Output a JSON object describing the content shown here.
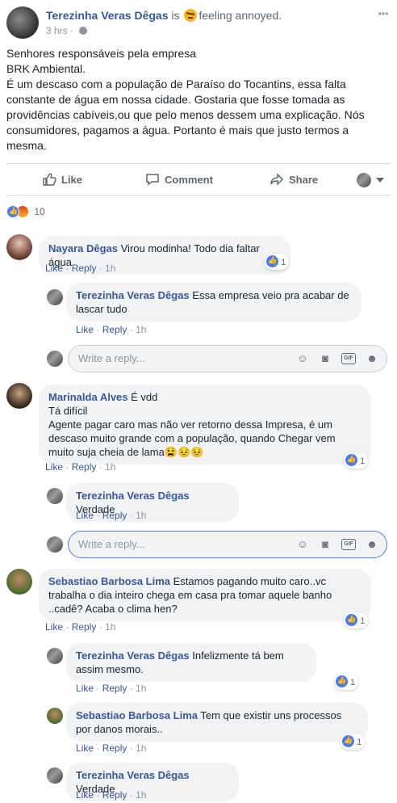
{
  "post": {
    "author": "Terezinha Veras Dêgas",
    "feeling_prefix": "is",
    "feeling_text": "feeling annoyed.",
    "time": "3 hrs",
    "separator": "·",
    "body": [
      "Senhores responsáveis pela empresa",
      "BRK Ambiental.",
      "É um descaso com a população de Paraíso do Tocantins, essa falta constante de água em nossa cidade. Gostaria que fosse tomada as providências cabíveis,ou que pelo menos dessem uma explicação. Nós consumidores, pagamos a água. Portanto é mais que justo termos a mesma."
    ]
  },
  "actions": {
    "like": "Like",
    "comment": "Comment",
    "share": "Share"
  },
  "reactions": {
    "count": "10"
  },
  "comments": [
    {
      "name": "Nayara Dêgas",
      "text": "Virou modinha! Todo dia faltar água",
      "like": "Like",
      "reply": "Reply",
      "time": "1h",
      "reactions": "1",
      "replies": [
        {
          "name": "Terezinha Veras Dêgas",
          "text": "Essa empresa veio pra acabar de lascar tudo",
          "like": "Like",
          "reply": "Reply",
          "time": "1h"
        }
      ]
    },
    {
      "name": "Marinalda Alves",
      "text_lines": [
        "É vdd",
        "Tá difícil",
        "Agente pagar caro mas não ver retorno dessa Impresa, é um descaso muito grande com a população, quando Chegar vem muito suja cheia de lama😫😣😣"
      ],
      "like": "Like",
      "reply": "Reply",
      "time": "1h",
      "reactions": "1",
      "replies": [
        {
          "name": "Terezinha Veras Dêgas",
          "text": "Verdade",
          "like": "Like",
          "reply": "Reply",
          "time": "1h"
        }
      ]
    },
    {
      "name": "Sebastiao Barbosa Lima",
      "text": "Estamos pagando muito caro..vc trabalha o dia inteiro chega em casa pra tomar aquele banho ..cadê? Acaba o clima hen?",
      "like": "Like",
      "reply": "Reply",
      "time": "1h",
      "reactions": "1",
      "replies": [
        {
          "name": "Terezinha Veras Dêgas",
          "text": "Infelizmente tá bem assim mesmo.",
          "like": "Like",
          "reply": "Reply",
          "time": "1h",
          "reactions": "1"
        },
        {
          "name": "Sebastiao Barbosa Lima",
          "text": "Tem que existir uns processos por danos morais..",
          "like": "Like",
          "reply": "Reply",
          "time": "1h",
          "reactions": "1"
        },
        {
          "name": "Terezinha Veras Dêgas",
          "text": "Verdade",
          "like": "Like",
          "reply": "Reply",
          "time": "1h"
        }
      ]
    }
  ],
  "reply_box": {
    "placeholder": "Write a reply..."
  },
  "icons": [
    "ellipsis-icon",
    "globe-icon",
    "like-icon",
    "comment-icon",
    "share-icon",
    "caret-down-icon",
    "emoji-icon",
    "camera-icon",
    "gif-icon",
    "sticker-icon"
  ],
  "colors": {
    "link": "#385898",
    "bubble": "#f2f3f5",
    "like_blue": "#4a7cf0"
  }
}
